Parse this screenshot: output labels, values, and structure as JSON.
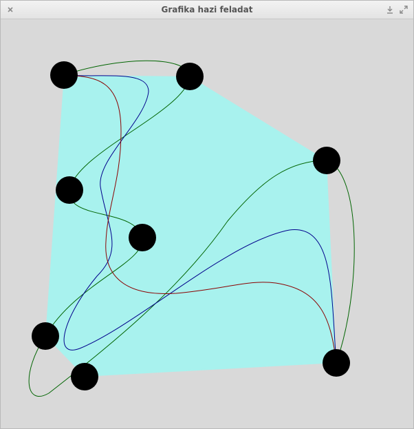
{
  "window": {
    "title": "Grafika hazi feladat",
    "background_color": "#d9d9d9"
  },
  "titlebar": {
    "close_icon": "close-icon",
    "minimize_icon": "download-arrow-icon",
    "maximize_icon": "expand-arrows-icon"
  },
  "graph": {
    "hull_color": "#a8f2ee",
    "node_color": "#000000",
    "node_count": 8,
    "edge_count": 7,
    "edge_colors": [
      "#006400",
      "#00008b",
      "#8b0000"
    ]
  }
}
